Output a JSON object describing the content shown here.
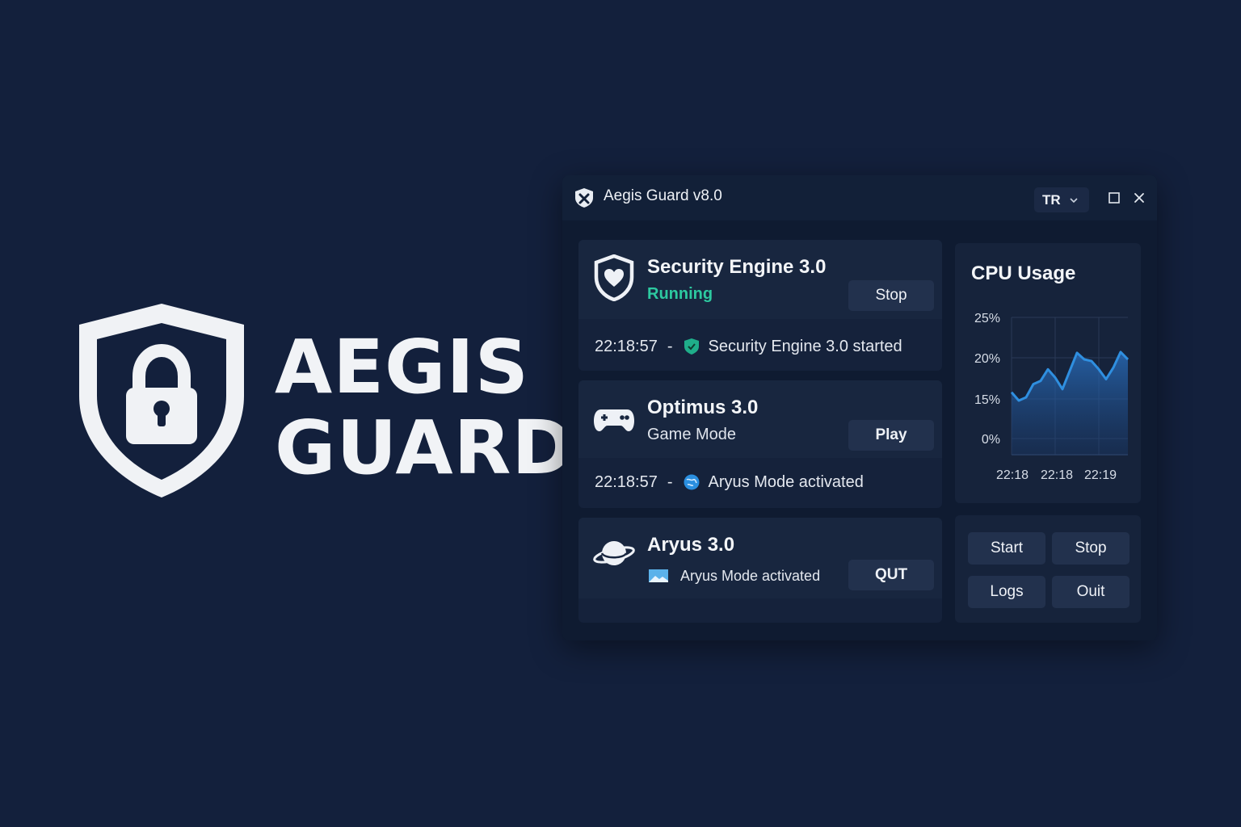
{
  "brand": {
    "line1": "AEGIS",
    "line2": "GUARD",
    "logo_icon": "shield-lock-icon"
  },
  "window": {
    "title": "Aegis Guard v8.0",
    "app_icon": "shield-x-icon",
    "language": {
      "selected": "TR"
    }
  },
  "modules": [
    {
      "name": "Security Engine 3.0",
      "status": "Running",
      "status_color": "#2dc9a0",
      "icon": "shield-heart-icon",
      "button": "Stop",
      "log": {
        "time": "22:18:57",
        "separator": "-",
        "icon": "green-shield-icon",
        "message": "Security Engine 3.0 started"
      }
    },
    {
      "name": "Optimus 3.0",
      "status": "Game Mode",
      "icon": "gamepad-icon",
      "button": "Play",
      "log": {
        "time": "22:18:57",
        "separator": "-",
        "icon": "blue-globe-icon",
        "message": "Aryus Mode activated"
      }
    },
    {
      "name": "Aryus 3.0",
      "icon": "planet-icon",
      "sub_icon": "image-icon",
      "sub_status": "Aryus Mode activated",
      "button": "QUT"
    }
  ],
  "cpu": {
    "title": "CPU Usage",
    "accent": "#2f8fe0"
  },
  "chart_data": {
    "type": "area",
    "title": "CPU Usage",
    "y_tick_labels": [
      "25%",
      "20%",
      "15%",
      "0%"
    ],
    "x_tick_labels": [
      "22:18",
      "22:18",
      "22:19"
    ],
    "y_values": [
      15.8,
      14.8,
      15.2,
      16.8,
      17.2,
      18.6,
      17.6,
      16.2,
      18.4,
      20.6,
      19.8,
      19.6,
      18.6,
      17.4,
      18.8,
      20.7,
      19.8
    ],
    "grid": true,
    "color": "#2f8fe0"
  },
  "controls": {
    "start": "Start",
    "stop": "Stop",
    "logs": "Logs",
    "quit": "Ouit"
  }
}
